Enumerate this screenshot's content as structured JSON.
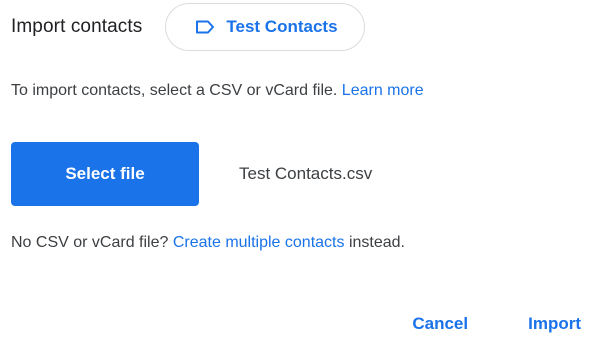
{
  "dialog": {
    "title": "Import contacts",
    "label_chip": {
      "icon": "label-icon",
      "text": "Test Contacts"
    },
    "instructions": {
      "text": "To import contacts, select a CSV or vCard file.",
      "link": "Learn more"
    },
    "select_file_button": "Select file",
    "selected_file_name": "Test Contacts.csv",
    "no_file": {
      "prefix": "No CSV or vCard file?",
      "link": "Create multiple contacts",
      "suffix": "instead."
    },
    "actions": {
      "cancel": "Cancel",
      "import": "Import"
    }
  },
  "colors": {
    "accent": "#1a73e8",
    "text": "#3c4043",
    "title": "#202124",
    "border": "#dadce0"
  }
}
